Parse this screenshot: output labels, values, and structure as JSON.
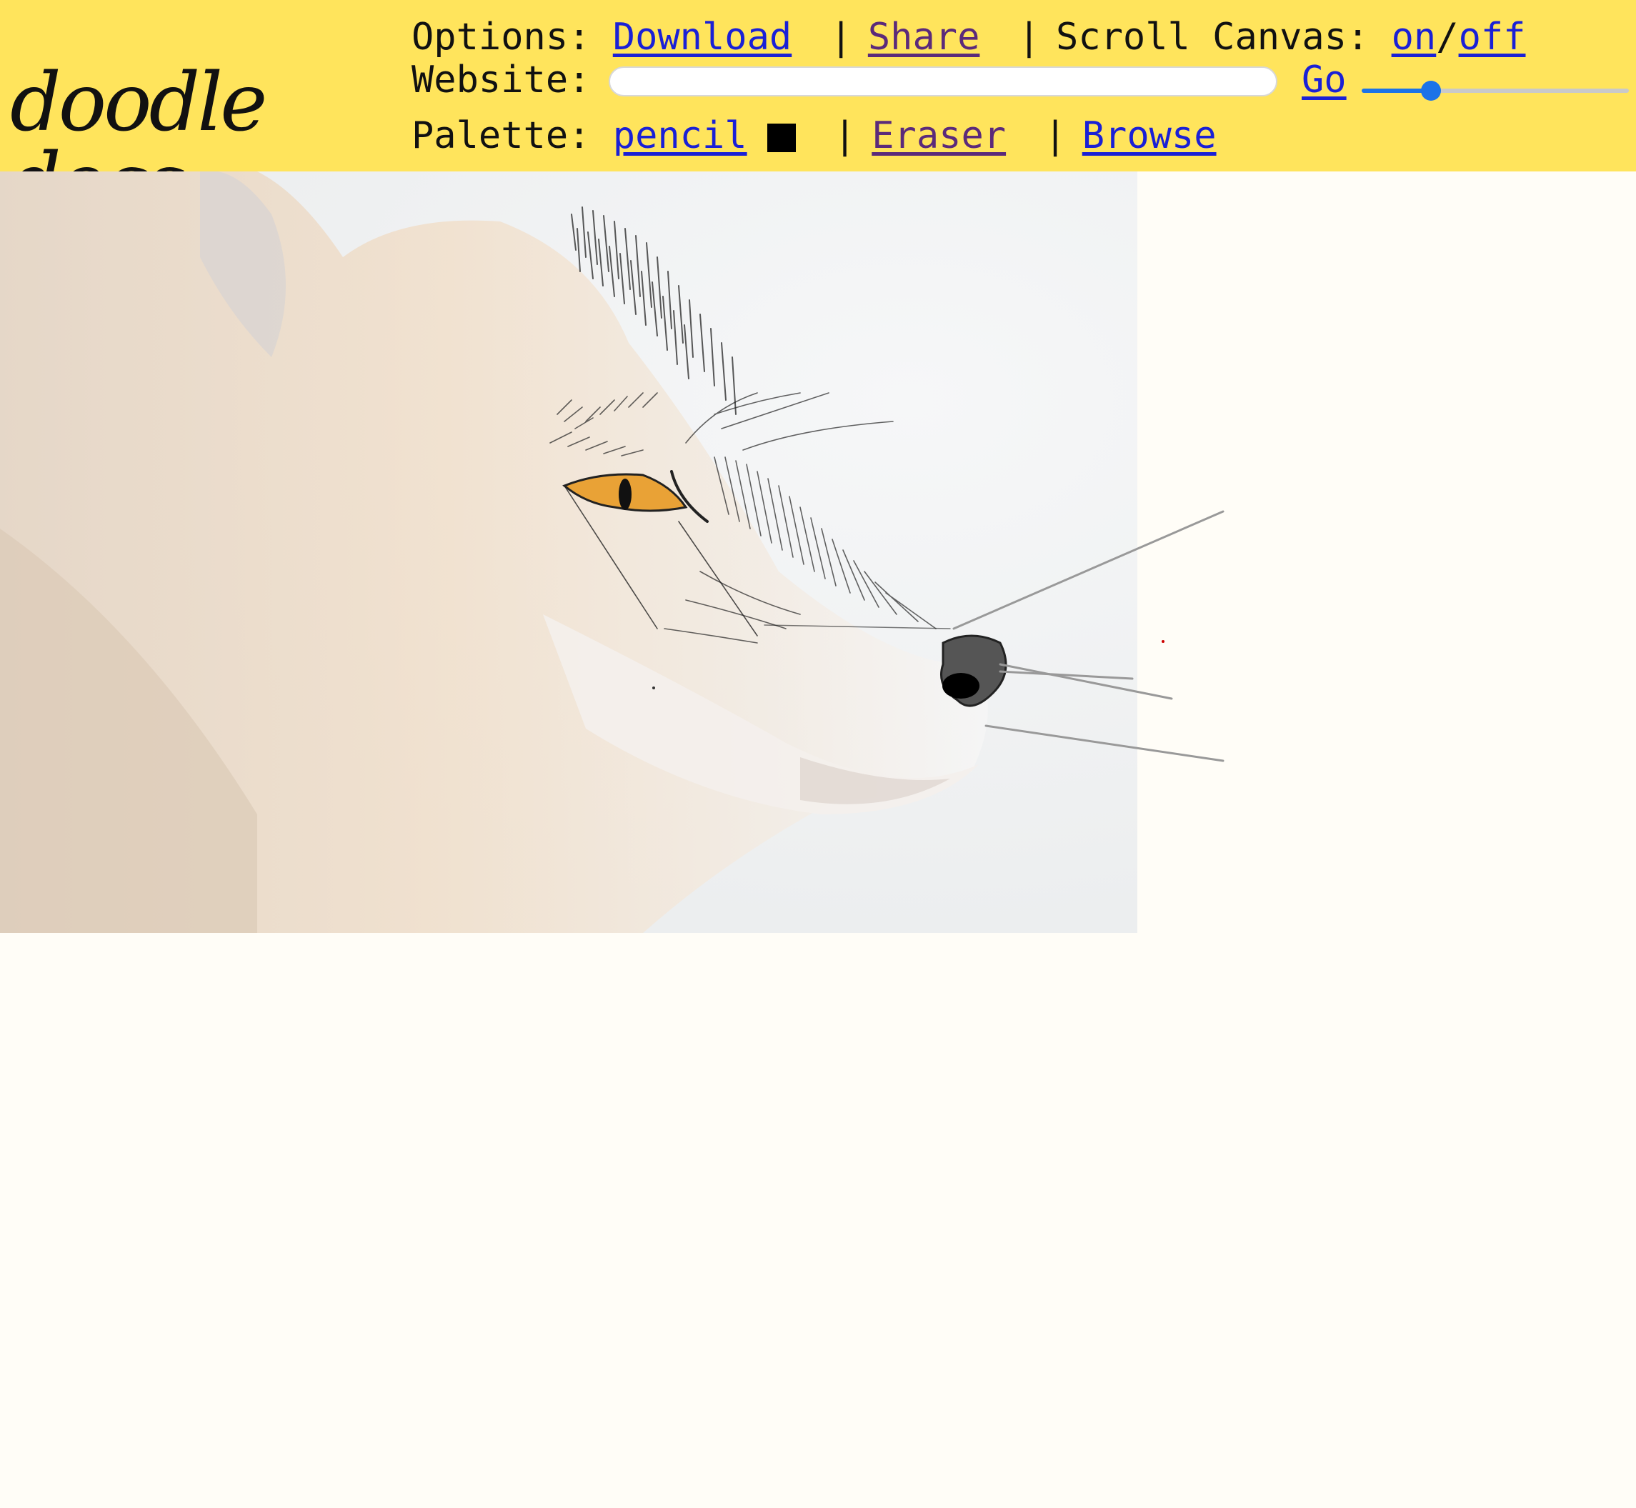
{
  "logo": {
    "text": "doodle docs."
  },
  "options": {
    "label": "Options:",
    "download": "Download",
    "share": "Share",
    "scroll_label": "Scroll Canvas:",
    "on": "on",
    "slash": "/",
    "off": "off"
  },
  "website": {
    "label": "Website:",
    "value": "",
    "placeholder": "",
    "go": "Go"
  },
  "palette": {
    "label": "Palette:",
    "pencil": "pencil",
    "color": "#000000",
    "eraser": "Eraser",
    "browse": "Browse"
  },
  "separator": "|",
  "brush_size": {
    "level": 0.26
  },
  "colors": {
    "toolbar_bg": "#ffe45c",
    "page_bg": "#fffdf7",
    "link": "#1a20d6",
    "visited_link": "#5b2a7a",
    "slider_accent": "#1b73e8"
  }
}
